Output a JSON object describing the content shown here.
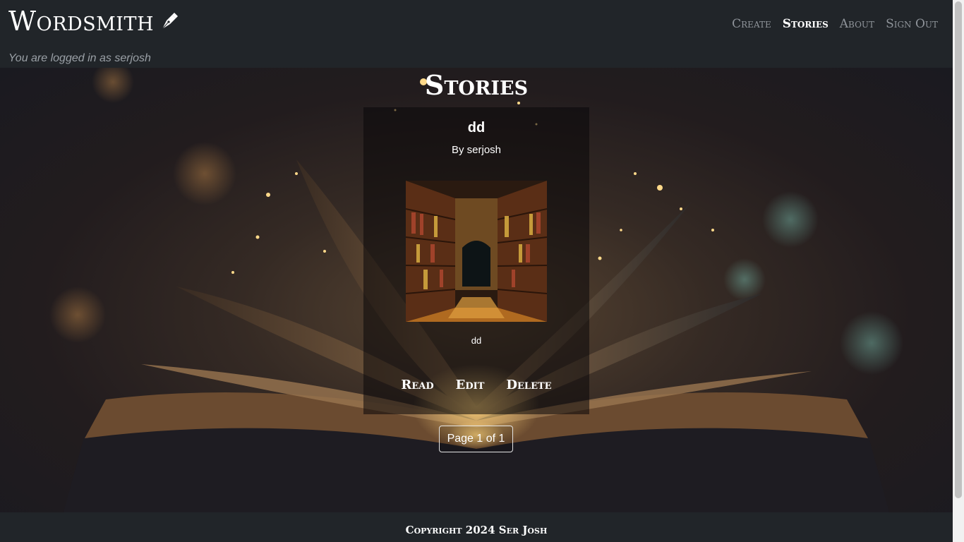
{
  "brand": {
    "title": "Wordsmith",
    "icon": "pen-nib-icon"
  },
  "login_note": "You are logged in as serjosh",
  "nav": [
    {
      "label": "Create",
      "active": false
    },
    {
      "label": "Stories",
      "active": true
    },
    {
      "label": "About",
      "active": false
    },
    {
      "label": "Sign Out",
      "active": false
    }
  ],
  "page": {
    "title": "Stories"
  },
  "story": {
    "title": "dd",
    "author": "By serjosh",
    "description": "dd",
    "actions": {
      "read": "Read",
      "edit": "Edit",
      "delete": "Delete"
    }
  },
  "pagination": {
    "text": "Page 1 of 1"
  },
  "footer": {
    "copyright": "Copyright 2024 Ser Josh"
  },
  "colors": {
    "navbar": "#212529",
    "muted_text": "#9aa0a6",
    "nav_inactive": "#8f949a"
  }
}
